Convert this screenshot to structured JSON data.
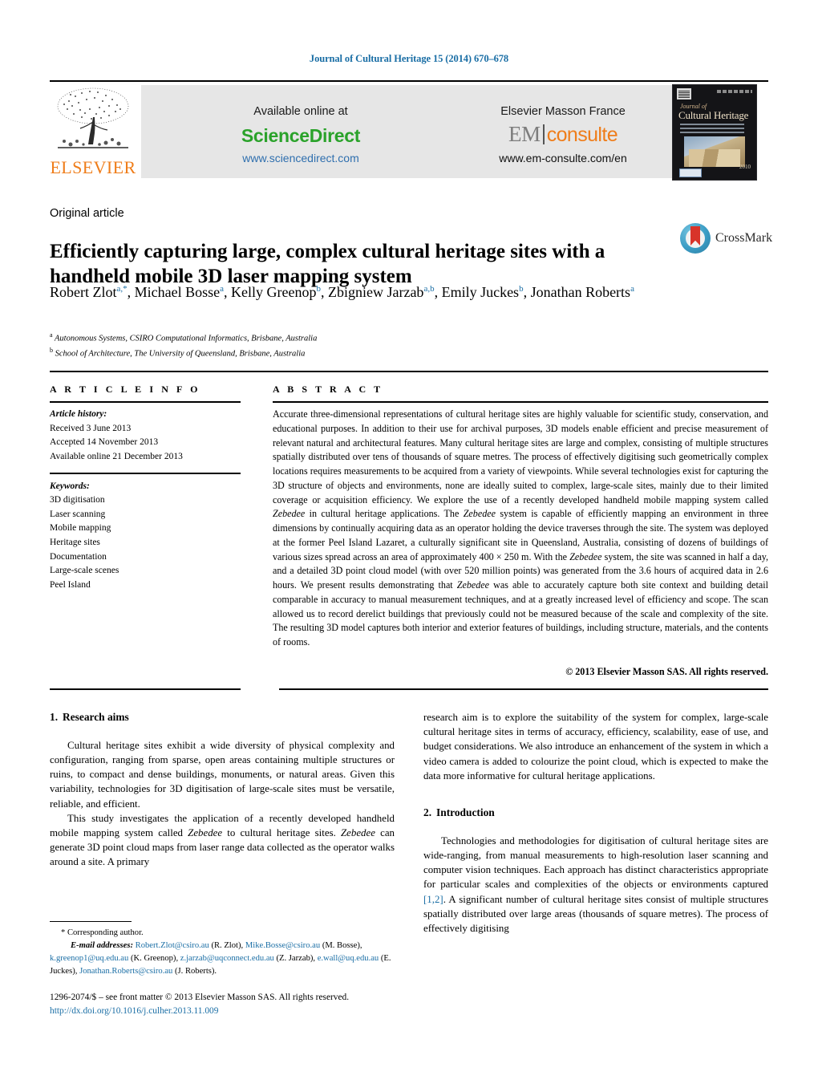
{
  "running_head": "Journal of Cultural Heritage 15 (2014) 670–678",
  "masthead": {
    "publisher_name": "ELSEVIER",
    "available_online": "Available online at",
    "sciencedirect": "ScienceDirect",
    "sciencedirect_url": "www.sciencedirect.com",
    "elsevier_masson": "Elsevier Masson France",
    "em_logo_em": "EM",
    "em_logo_consulte": "consulte",
    "em_url": "www.em-consulte.com/en",
    "cover": {
      "journal_word": "Journal of",
      "title": "Cultural Heritage",
      "year": "2010"
    }
  },
  "article": {
    "type": "Original article",
    "title": "Efficiently capturing large, complex cultural heritage sites with a handheld mobile 3D laser mapping system",
    "crossmark_label": "CrossMark",
    "authors_html": "Robert Zlot<sup>a,*</sup>, Michael Bosse<sup>a</sup>, Kelly Greenop<sup>b</sup>, Zbigniew Jarzab<sup>a,b</sup>, Emily Juckes<sup>b</sup>, Jonathan Roberts<sup>a</sup>",
    "affiliations": [
      {
        "mark": "a",
        "text": "Autonomous Systems, CSIRO Computational Informatics, Brisbane, Australia"
      },
      {
        "mark": "b",
        "text": "School of Architecture, The University of Queensland, Brisbane, Australia"
      }
    ]
  },
  "info": {
    "heading": "A R T I C L E   I N F O",
    "history_label": "Article history:",
    "history": [
      "Received 3 June 2013",
      "Accepted 14 November 2013",
      "Available online 21 December 2013"
    ],
    "keywords_label": "Keywords:",
    "keywords": [
      "3D digitisation",
      "Laser scanning",
      "Mobile mapping",
      "Heritage sites",
      "Documentation",
      "Large-scale scenes",
      "Peel Island"
    ]
  },
  "abstract": {
    "heading": "A B S T R A C T",
    "text": "Accurate three-dimensional representations of cultural heritage sites are highly valuable for scientific study, conservation, and educational purposes. In addition to their use for archival purposes, 3D models enable efficient and precise measurement of relevant natural and architectural features. Many cultural heritage sites are large and complex, consisting of multiple structures spatially distributed over tens of thousands of square metres. The process of effectively digitising such geometrically complex locations requires measurements to be acquired from a variety of viewpoints. While several technologies exist for capturing the 3D structure of objects and environments, none are ideally suited to complex, large-scale sites, mainly due to their limited coverage or acquisition efficiency. We explore the use of a recently developed handheld mobile mapping system called Zebedee in cultural heritage applications. The Zebedee system is capable of efficiently mapping an environment in three dimensions by continually acquiring data as an operator holding the device traverses through the site. The system was deployed at the former Peel Island Lazaret, a culturally significant site in Queensland, Australia, consisting of dozens of buildings of various sizes spread across an area of approximately 400 × 250 m. With the Zebedee system, the site was scanned in half a day, and a detailed 3D point cloud model (with over 520 million points) was generated from the 3.6 hours of acquired data in 2.6 hours. We present results demonstrating that Zebedee was able to accurately capture both site context and building detail comparable in accuracy to manual measurement techniques, and at a greatly increased level of efficiency and scope. The scan allowed us to record derelict buildings that previously could not be measured because of the scale and complexity of the site. The resulting 3D model captures both interior and exterior features of buildings, including structure, materials, and the contents of rooms.",
    "copyright": "© 2013 Elsevier Masson SAS. All rights reserved."
  },
  "body": {
    "left": {
      "section_number": "1.",
      "section_title": "Research aims",
      "paragraph_1": "Cultural heritage sites exhibit a wide diversity of physical complexity and configuration, ranging from sparse, open areas containing multiple structures or ruins, to compact and dense buildings, monuments, or natural areas. Given this variability, technologies for 3D digitisation of large-scale sites must be versatile, reliable, and efficient.",
      "paragraph_2_a": "This study investigates the application of a recently developed handheld mobile mapping system called ",
      "paragraph_2_italic_1": "Zebedee",
      "paragraph_2_b": " to cultural heritage sites. ",
      "paragraph_2_italic_2": "Zebedee",
      "paragraph_2_c": " can generate 3D point cloud maps from laser range data collected as the operator walks around a site. A primary"
    },
    "right": {
      "continuation": "research aim is to explore the suitability of the system for complex, large-scale cultural heritage sites in terms of accuracy, efficiency, scalability, ease of use, and budget considerations. We also introduce an enhancement of the system in which a video camera is added to colourize the point cloud, which is expected to make the data more informative for cultural heritage applications.",
      "section_number": "2.",
      "section_title": "Introduction",
      "paragraph_1_a": "Technologies and methodologies for digitisation of cultural heritage sites are wide-ranging, from manual measurements to high-resolution laser scanning and computer vision techniques. Each approach has distinct characteristics appropriate for particular scales and complexities of the objects or environments captured ",
      "paragraph_1_ref": "[1,2]",
      "paragraph_1_b": ". A significant number of cultural heritage sites consist of multiple structures spatially distributed over large areas (thousands of square metres). The process of effectively digitising"
    }
  },
  "footnotes": {
    "corresponding": "* Corresponding author.",
    "email_label": "E-mail addresses:",
    "emails": [
      {
        "address": "Robert.Zlot@csiro.au",
        "name": "(R. Zlot),"
      },
      {
        "address": "Mike.Bosse@csiro.au",
        "name": "(M. Bosse),"
      },
      {
        "address": "k.greenop1@uq.edu.au",
        "name": "(K. Greenop),"
      },
      {
        "address": "z.jarzab@uqconnect.edu.au",
        "name": "(Z. Jarzab),"
      },
      {
        "address": "e.wall@uq.edu.au",
        "name": "(E. Juckes),"
      },
      {
        "address": "Jonathan.Roberts@csiro.au",
        "name": "(J. Roberts)."
      }
    ],
    "issn_line": "1296-2074/$ – see front matter © 2013 Elsevier Masson SAS. All rights reserved.",
    "doi": "http://dx.doi.org/10.1016/j.culher.2013.11.009"
  },
  "colors": {
    "link": "#1a6ea5",
    "elsevier_orange": "#ef7d1a",
    "sciencedirect_green": "#2aa22a",
    "band_grey": "#e6e6e6"
  }
}
